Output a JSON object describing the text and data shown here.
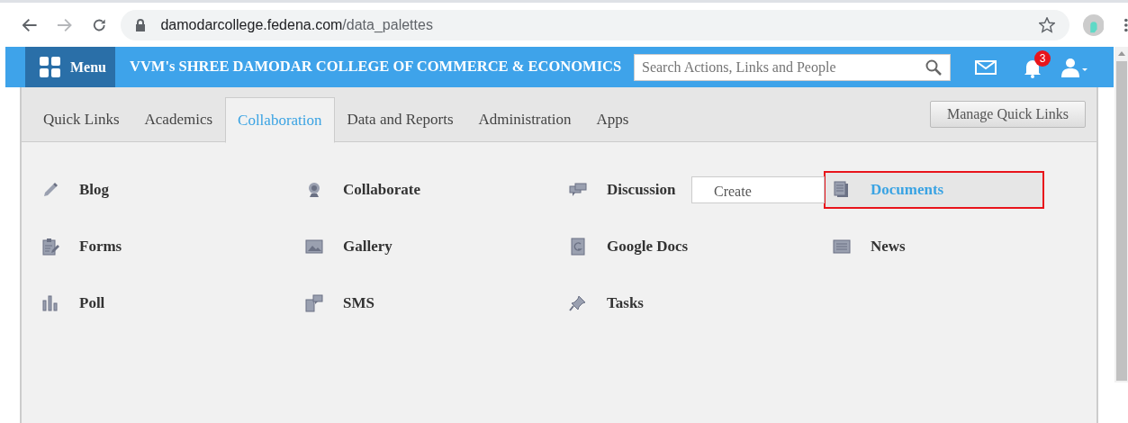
{
  "browser": {
    "url_host": "damodarcollege.fedena.com",
    "url_path": "/data_palettes"
  },
  "header": {
    "menu_label": "Menu",
    "title": "VVM's SHREE DAMODAR COLLEGE OF COMMERCE & ECONOMICS",
    "search_placeholder": "Search Actions, Links and People",
    "notification_count": "3"
  },
  "tabs": [
    {
      "label": "Quick Links",
      "selected": false
    },
    {
      "label": "Academics",
      "selected": false
    },
    {
      "label": "Collaboration",
      "selected": true
    },
    {
      "label": "Data and Reports",
      "selected": false
    },
    {
      "label": "Administration",
      "selected": false
    },
    {
      "label": "Apps",
      "selected": false
    }
  ],
  "manage_button": "Manage Quick Links",
  "items": [
    {
      "label": "Blog",
      "highlighted": false
    },
    {
      "label": "Collaborate",
      "highlighted": false
    },
    {
      "label": "Discussion",
      "highlighted": false
    },
    {
      "label": "Documents",
      "highlighted": true
    },
    {
      "label": "Forms",
      "highlighted": false
    },
    {
      "label": "Gallery",
      "highlighted": false
    },
    {
      "label": "Google Docs",
      "highlighted": false
    },
    {
      "label": "News",
      "highlighted": false
    },
    {
      "label": "Poll",
      "highlighted": false
    },
    {
      "label": "SMS",
      "highlighted": false
    },
    {
      "label": "Tasks",
      "highlighted": false
    }
  ],
  "popup": {
    "label": "Create"
  }
}
